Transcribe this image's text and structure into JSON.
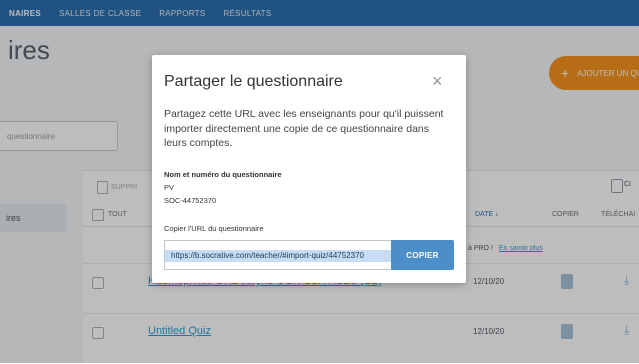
{
  "nav": {
    "items": [
      {
        "label": "NAIRES",
        "active": true
      },
      {
        "label": "SALLES DE CLASSE",
        "active": false
      },
      {
        "label": "RAPPORTS",
        "active": false
      },
      {
        "label": "RÉSULTATS",
        "active": false
      }
    ]
  },
  "page": {
    "title": "ires",
    "add_button": "AJOUTER UN QU",
    "search_placeholder": "questionnaire",
    "left_nav_item": "ires"
  },
  "table": {
    "delete_label": "SUPPRI",
    "copy_top_label": "CI",
    "headers": {
      "all": "TOUT",
      "date": "DATE ↓",
      "copy": "COPIER",
      "download": "TÉLÉCHAI"
    },
    "promo_text": "à PRO !",
    "promo_link": "En savoir plus",
    "rows": [
      {
        "name": "Haemophilus ORL coryne CGN LCR ASLO (B2)",
        "date": "12/10/20"
      },
      {
        "name": "Untitled Quiz",
        "date": "12/10/20"
      }
    ]
  },
  "modal": {
    "title": "Partager le questionnaire",
    "description": "Partagez cette URL avec les enseignants pour qu'il puissent importer directement une copie de ce questionnaire dans leurs comptes.",
    "name_label": "Nom et numéro du questionnaire",
    "quiz_name": "PV",
    "quiz_id": "SOC-44752370",
    "url_label": "Copier l'URL du questionnaire",
    "url_value": "https://b.socrative.com/teacher/#import-quiz/44752370",
    "copy_button": "COPIER"
  },
  "colors": {
    "nav_bg": "#2c6fb0",
    "accent_orange": "#f7941d",
    "copy_button": "#4c8ec7",
    "link": "#2f9fd6"
  }
}
